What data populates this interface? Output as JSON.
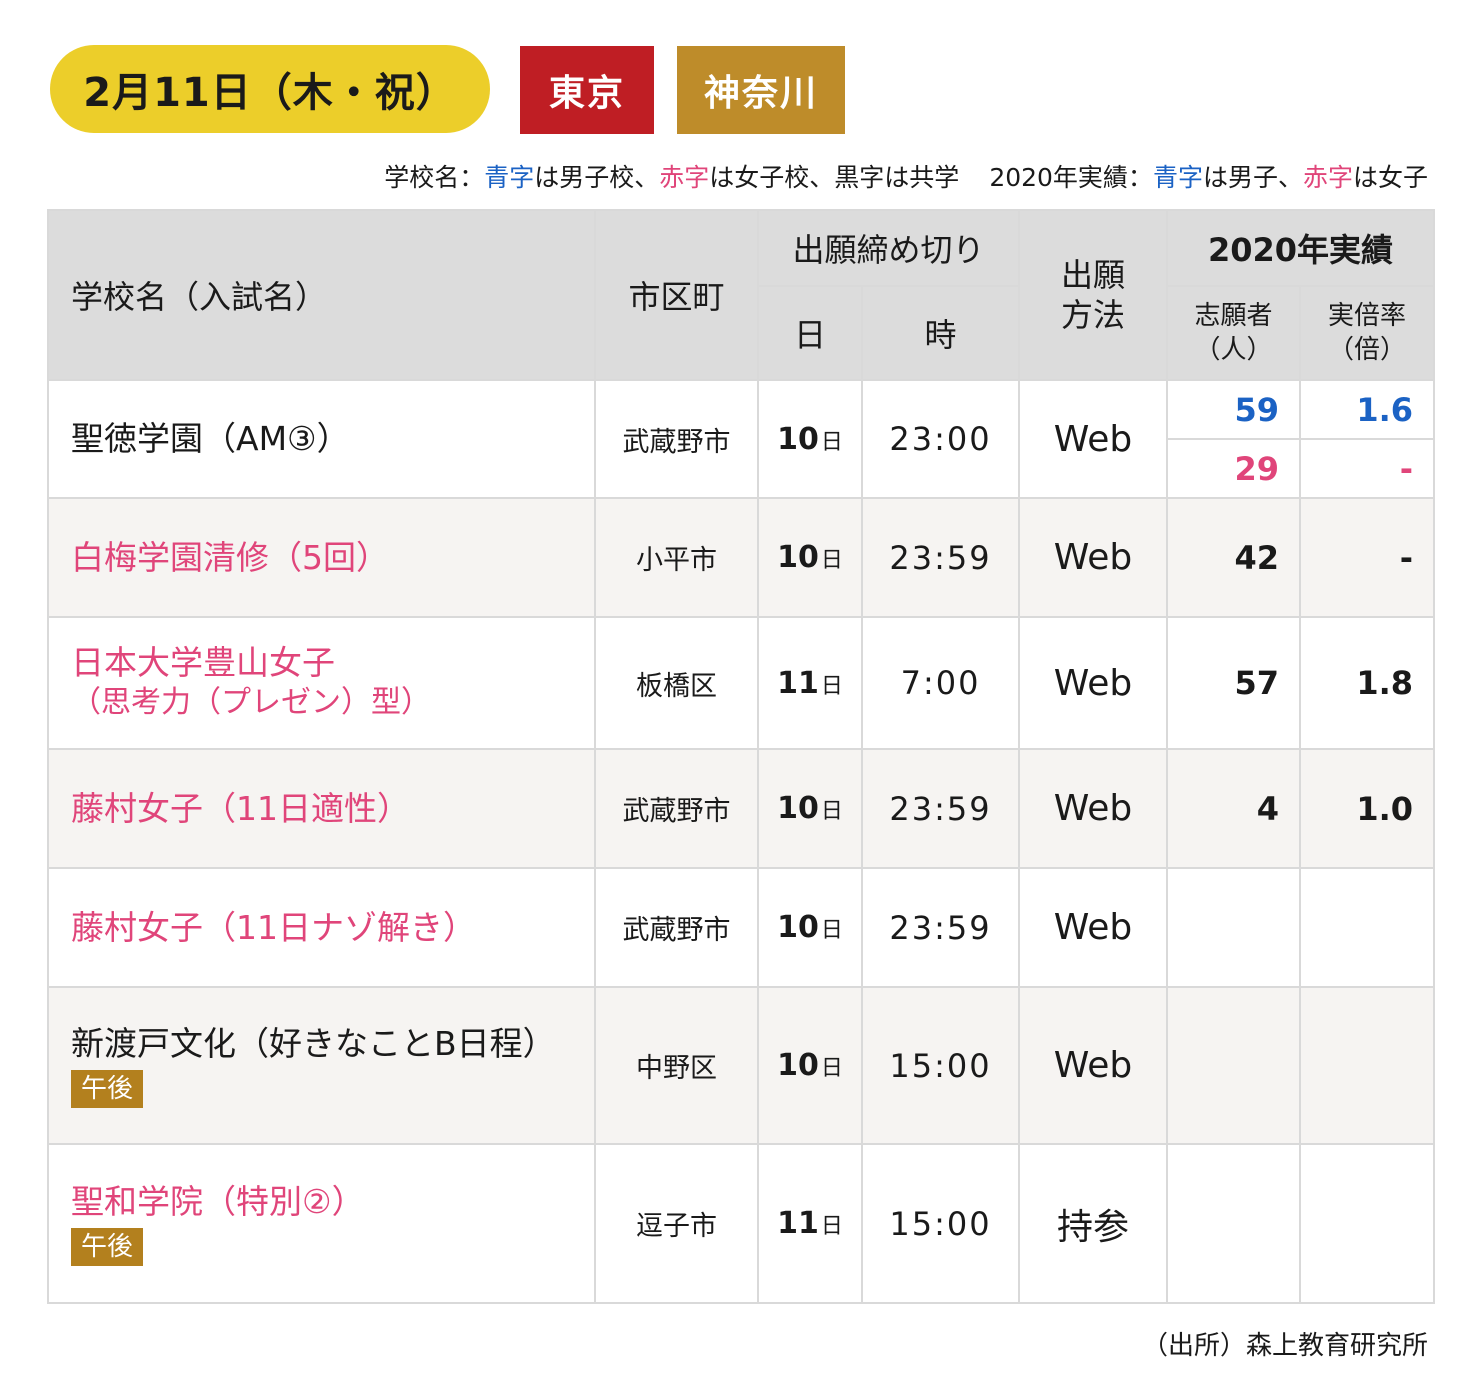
{
  "header": {
    "date": "2月11日（木・祝）",
    "prefectures": [
      "東京",
      "神奈川"
    ],
    "colors": {
      "date_pill": "#ecce2a",
      "tokyo": "#bf1e24",
      "kanagawa": "#be8c2a"
    }
  },
  "legend": {
    "p1": "学校名：",
    "p2": "青字",
    "p3": "は男子校、",
    "p4": "赤字",
    "p5": "は女子校、黒字は共学",
    "p6": "2020年実績：",
    "p7": "青字",
    "p8": "は男子、",
    "p9": "赤字",
    "p10": "は女子"
  },
  "table": {
    "headers": {
      "school": "学校名（入試名）",
      "city": "市区町",
      "deadline": "出願締め切り",
      "day": "日",
      "time": "時",
      "method_l1": "出願",
      "method_l2": "方法",
      "results": "2020年実績",
      "applicants_l1": "志願者",
      "applicants_l2": "（人）",
      "ratio_l1": "実倍率",
      "ratio_l2": "（倍）"
    },
    "rows": [
      {
        "name": "聖徳学園（AM③）",
        "city": "武蔵野市",
        "day": "10",
        "day_unit": "日",
        "time": "23:00",
        "method": "Web",
        "applicants_m": "59",
        "ratio_m": "1.6",
        "applicants_f": "29",
        "ratio_f": "-"
      },
      {
        "name": "白梅学園清修（5回）",
        "city": "小平市",
        "day": "10",
        "day_unit": "日",
        "time": "23:59",
        "method": "Web",
        "applicants": "42",
        "ratio": "-"
      },
      {
        "name": "日本大学豊山女子",
        "name_sub": "（思考力（プレゼン）型）",
        "city": "板橋区",
        "day": "11",
        "day_unit": "日",
        "time": "7:00",
        "method": "Web",
        "applicants": "57",
        "ratio": "1.8"
      },
      {
        "name": "藤村女子（11日適性）",
        "city": "武蔵野市",
        "day": "10",
        "day_unit": "日",
        "time": "23:59",
        "method": "Web",
        "applicants": "4",
        "ratio": "1.0"
      },
      {
        "name": "藤村女子（11日ナゾ解き）",
        "city": "武蔵野市",
        "day": "10",
        "day_unit": "日",
        "time": "23:59",
        "method": "Web",
        "applicants": "",
        "ratio": ""
      },
      {
        "name": "新渡戸文化（好きなことB日程）",
        "badge": "午後",
        "city": "中野区",
        "day": "10",
        "day_unit": "日",
        "time": "15:00",
        "method": "Web",
        "applicants": "",
        "ratio": ""
      },
      {
        "name": "聖和学院（特別②）",
        "badge": "午後",
        "city": "逗子市",
        "day": "11",
        "day_unit": "日",
        "time": "15:00",
        "method": "持参",
        "applicants": "",
        "ratio": ""
      }
    ]
  },
  "source": "（出所）森上教育研究所"
}
